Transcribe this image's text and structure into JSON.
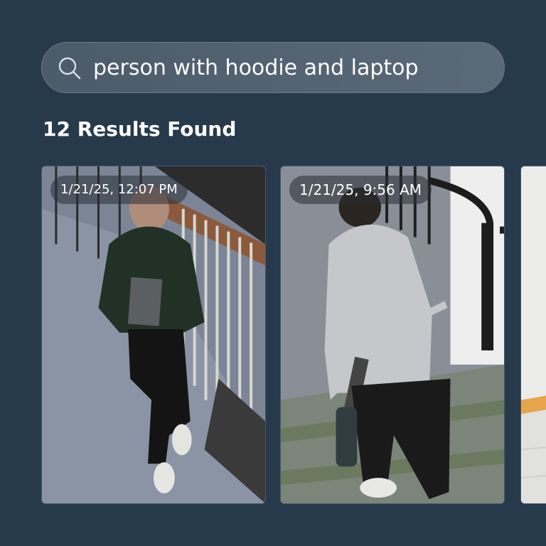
{
  "search": {
    "query": "person with hoodie and laptop",
    "icon": "search-icon"
  },
  "results": {
    "heading": "12 Results Found",
    "items": [
      {
        "timestamp": "1/21/25, 12:07 PM"
      },
      {
        "timestamp": "1/21/25, 9:56 AM"
      },
      {
        "timestamp": ""
      }
    ]
  },
  "colors": {
    "background": "#263a4b",
    "search_bar": "#55646f",
    "text": "#ffffff"
  }
}
